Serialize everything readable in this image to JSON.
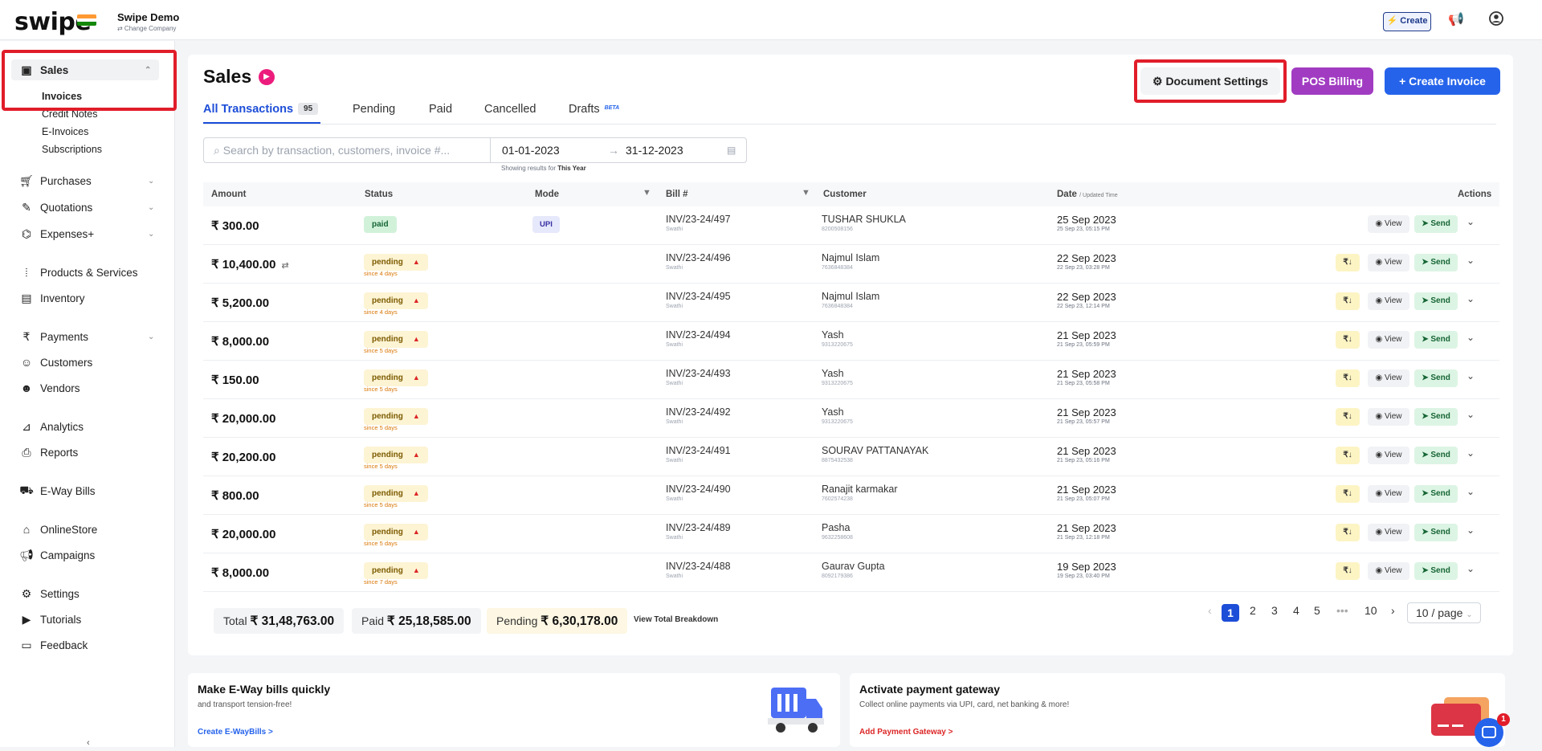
{
  "brand": {
    "logo": "swipe",
    "company_name": "Swipe Demo",
    "change_company": "⇄ Change Company"
  },
  "topbar": {
    "create_label": "⚡ Create"
  },
  "sidebar": {
    "sales": "Sales",
    "sales_sub": [
      "Invoices",
      "Credit Notes",
      "E-Invoices",
      "Subscriptions"
    ],
    "items": [
      {
        "label": "Purchases",
        "icon": "cart-icon"
      },
      {
        "label": "Quotations",
        "icon": "pen-icon"
      },
      {
        "label": "Expenses+",
        "icon": "tag-icon"
      },
      {
        "label": "Products & Services",
        "icon": "barcode-icon"
      },
      {
        "label": "Inventory",
        "icon": "warehouse-icon"
      },
      {
        "label": "Payments",
        "icon": "rupee-icon"
      },
      {
        "label": "Customers",
        "icon": "user-icon"
      },
      {
        "label": "Vendors",
        "icon": "users-icon"
      },
      {
        "label": "Analytics",
        "icon": "chart-icon"
      },
      {
        "label": "Reports",
        "icon": "report-icon"
      },
      {
        "label": "E-Way Bills",
        "icon": "truck-icon"
      },
      {
        "label": "OnlineStore",
        "icon": "store-icon"
      },
      {
        "label": "Campaigns",
        "icon": "megaphone-icon"
      },
      {
        "label": "Settings",
        "icon": "gear-icon"
      },
      {
        "label": "Tutorials",
        "icon": "youtube-icon"
      },
      {
        "label": "Feedback",
        "icon": "chat-icon"
      }
    ]
  },
  "page": {
    "title": "Sales",
    "doc_settings": "Document Settings",
    "pos_billing": "POS Billing",
    "create_invoice": "+ Create Invoice"
  },
  "tabs": [
    {
      "label": "All Transactions",
      "count": "95"
    },
    {
      "label": "Pending"
    },
    {
      "label": "Paid"
    },
    {
      "label": "Cancelled"
    },
    {
      "label": "Drafts",
      "badge": "BETA"
    }
  ],
  "search": {
    "placeholder": "Search by transaction, customers, invoice #..."
  },
  "daterange": {
    "start": "01-01-2023",
    "end": "31-12-2023",
    "showing_prefix": "Showing results for",
    "showing_period": "This Year"
  },
  "table": {
    "headers": {
      "amount": "Amount",
      "status": "Status",
      "mode": "Mode",
      "bill": "Bill #",
      "customer": "Customer",
      "date": "Date",
      "date_sub": "/ Updated Time",
      "actions": "Actions"
    },
    "rows": [
      {
        "amount": "₹ 300.00",
        "status": "paid",
        "since": "",
        "mode": "UPI",
        "bill": "INV/23-24/497",
        "bill_sub": "Swathi",
        "customer": "TUSHAR SHUKLA",
        "phone": "8200508156",
        "date": "25 Sep 2023",
        "updated": "25 Sep 23, 05:15 PM"
      },
      {
        "amount": "₹ 10,400.00",
        "status": "pending",
        "since": "since 4 days",
        "mode": "",
        "bill": "INV/23-24/496",
        "bill_sub": "Swathi",
        "customer": "Najmul Islam",
        "phone": "7636848384",
        "date": "22 Sep 2023",
        "updated": "22 Sep 23, 03:28 PM"
      },
      {
        "amount": "₹ 5,200.00",
        "status": "pending",
        "since": "since 4 days",
        "mode": "",
        "bill": "INV/23-24/495",
        "bill_sub": "Swathi",
        "customer": "Najmul Islam",
        "phone": "7636848384",
        "date": "22 Sep 2023",
        "updated": "22 Sep 23, 12:14 PM"
      },
      {
        "amount": "₹ 8,000.00",
        "status": "pending",
        "since": "since 5 days",
        "mode": "",
        "bill": "INV/23-24/494",
        "bill_sub": "Swathi",
        "customer": "Yash",
        "phone": "9313220675",
        "date": "21 Sep 2023",
        "updated": "21 Sep 23, 05:59 PM"
      },
      {
        "amount": "₹ 150.00",
        "status": "pending",
        "since": "since 5 days",
        "mode": "",
        "bill": "INV/23-24/493",
        "bill_sub": "Swathi",
        "customer": "Yash",
        "phone": "9313220675",
        "date": "21 Sep 2023",
        "updated": "21 Sep 23, 05:58 PM"
      },
      {
        "amount": "₹ 20,000.00",
        "status": "pending",
        "since": "since 5 days",
        "mode": "",
        "bill": "INV/23-24/492",
        "bill_sub": "Swathi",
        "customer": "Yash",
        "phone": "9313220675",
        "date": "21 Sep 2023",
        "updated": "21 Sep 23, 05:57 PM"
      },
      {
        "amount": "₹ 20,200.00",
        "status": "pending",
        "since": "since 5 days",
        "mode": "",
        "bill": "INV/23-24/491",
        "bill_sub": "Swathi",
        "customer": "SOURAV PATTANAYAK",
        "phone": "8875432538",
        "date": "21 Sep 2023",
        "updated": "21 Sep 23, 05:16 PM"
      },
      {
        "amount": "₹ 800.00",
        "status": "pending",
        "since": "since 5 days",
        "mode": "",
        "bill": "INV/23-24/490",
        "bill_sub": "Swathi",
        "customer": "Ranajit karmakar",
        "phone": "7602574238",
        "date": "21 Sep 2023",
        "updated": "21 Sep 23, 05:07 PM"
      },
      {
        "amount": "₹ 20,000.00",
        "status": "pending",
        "since": "since 5 days",
        "mode": "",
        "bill": "INV/23-24/489",
        "bill_sub": "Swathi",
        "customer": "Pasha",
        "phone": "9632258608",
        "date": "21 Sep 2023",
        "updated": "21 Sep 23, 12:18 PM"
      },
      {
        "amount": "₹ 8,000.00",
        "status": "pending",
        "since": "since 7 days",
        "mode": "",
        "bill": "INV/23-24/488",
        "bill_sub": "Swathi",
        "customer": "Gaurav Gupta",
        "phone": "8092179386",
        "date": "19 Sep 2023",
        "updated": "19 Sep 23, 03:40 PM"
      }
    ],
    "view_label": "View",
    "send_label": "Send",
    "pay_label": "₹↓"
  },
  "totals": {
    "total_label": "Total",
    "total": "₹ 31,48,763.00",
    "paid_label": "Paid",
    "paid": "₹ 25,18,585.00",
    "pending_label": "Pending",
    "pending": "₹ 6,30,178.00",
    "breakdown": "View Total Breakdown"
  },
  "pagination": {
    "pages": [
      "1",
      "2",
      "3",
      "4",
      "5",
      "•••",
      "10"
    ],
    "current": "1",
    "per_page": "10 / page"
  },
  "promos": [
    {
      "title": "Make E-Way bills quickly",
      "subtitle": "and transport tension-free!",
      "link": "Create E-WayBills >"
    },
    {
      "title": "Activate payment gateway",
      "subtitle": "Collect online payments via UPI, card, net banking & more!",
      "link": "Add Payment Gateway >"
    }
  ],
  "chat_badge": "1",
  "colors": {
    "accent": "#2563eb",
    "pos": "#a13cc2",
    "highlight": "#e11d2a"
  }
}
